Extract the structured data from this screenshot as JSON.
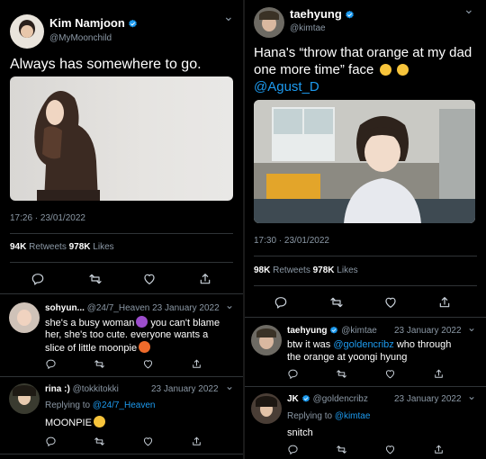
{
  "left": {
    "tweet": {
      "name": "Kim Namjoon",
      "handle": "@MyMoonchild",
      "text": "Always has somewhere to go.",
      "time": "17:26 · 23/01/2022",
      "retweets": "94K",
      "retweets_label": "Retweets",
      "likes": "978K",
      "likes_label": "Likes"
    },
    "replies": [
      {
        "name": "sohyun...",
        "handle": "@24/7_Heaven",
        "date": "23 January 2022",
        "lines": [
          "she's a busy woman",
          " you can't blame",
          "her, she's too cute. everyone wants a",
          "slice of little moonpie"
        ]
      },
      {
        "name": "rina :)",
        "handle": "@tokkitokki",
        "date": "23 January 2022",
        "replying_label": "Replying to",
        "replying_to": "@24/7_Heaven",
        "text": "MOONPIE"
      }
    ]
  },
  "right": {
    "tweet": {
      "name": "taehyung",
      "handle": "@kimtae",
      "text_line1": "Hana's “throw that orange at my dad",
      "text_line2": "one more time” face",
      "mention": "@Agust_D",
      "time": "17:30 · 23/01/2022",
      "retweets": "98K",
      "retweets_label": "Retweets",
      "likes": "978K",
      "likes_label": "Likes"
    },
    "replies": [
      {
        "name": "taehyung",
        "handle": "@kimtae",
        "date": "23 January 2022",
        "text_before": "btw it was ",
        "mention": "@goldencribz",
        "text_after": " who through",
        "line2": "the orange at yoongi hyung"
      },
      {
        "name": "JK",
        "handle": "@goldencribz",
        "date": "23 January 2022",
        "replying_label": "Replying to",
        "replying_to": "@kimtae",
        "text": "snitch"
      }
    ]
  },
  "colors": {
    "background": "#000000",
    "muted": "#8b98a5",
    "link": "#1d9bf0",
    "verified": "#1d9bf0",
    "divider": "#2f3336"
  },
  "icons": [
    "reply-icon",
    "retweet-icon",
    "like-icon",
    "share-icon",
    "verified-icon",
    "chevron-down-icon"
  ]
}
